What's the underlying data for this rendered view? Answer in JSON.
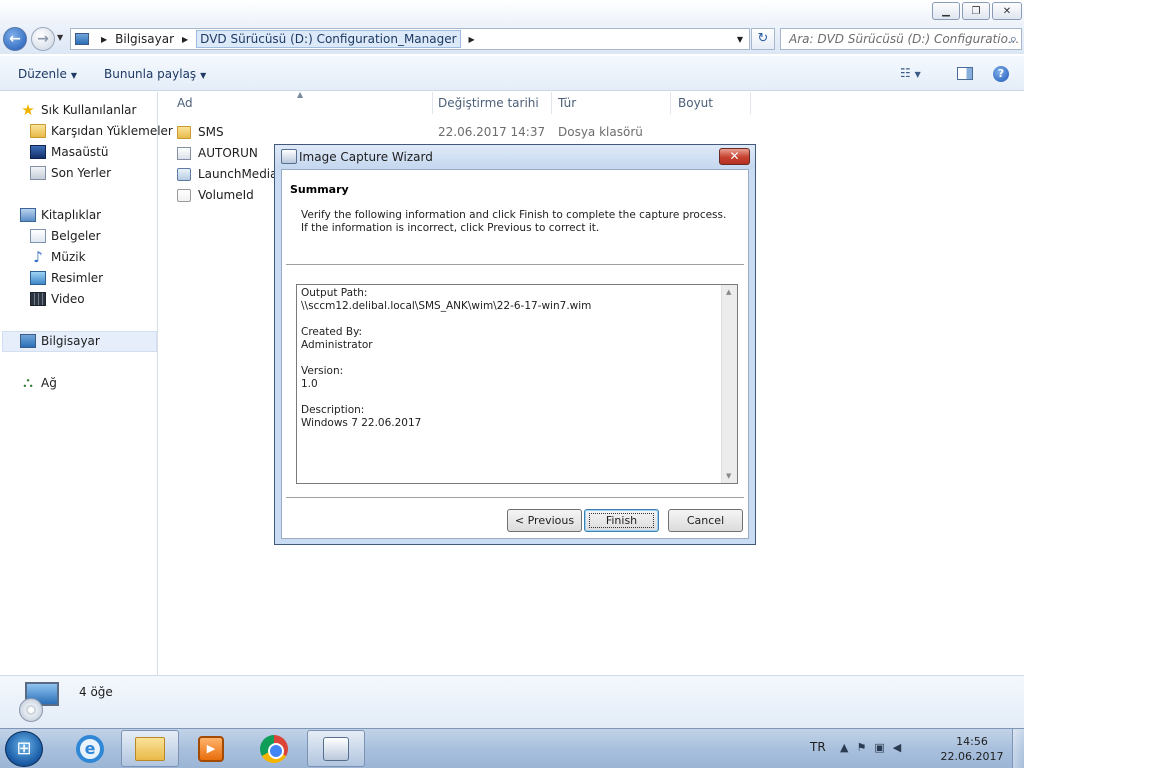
{
  "address": {
    "crumbs": [
      "Bilgisayar",
      "DVD Sürücüsü (D:) Configuration_Manager"
    ],
    "search_placeholder": "Ara: DVD Sürücüsü (D:) Configuratio..."
  },
  "toolbar": {
    "organize_label": "Düzenle",
    "share_label": "Bununla paylaş"
  },
  "nav": {
    "favorites": {
      "label": "Sık Kullanılanlar",
      "items": [
        "Karşıdan Yüklemeler",
        "Masaüstü",
        "Son Yerler"
      ]
    },
    "libraries": {
      "label": "Kitaplıklar",
      "items": [
        "Belgeler",
        "Müzik",
        "Resimler",
        "Video"
      ]
    },
    "computer_label": "Bilgisayar",
    "network_label": "Ağ"
  },
  "columns": [
    "Ad",
    "Değiştirme tarihi",
    "Tür",
    "Boyut"
  ],
  "files": [
    {
      "name": "SMS",
      "date": "22.06.2017 14:37",
      "type": "Dosya klasörü",
      "icon": "folder-icon"
    },
    {
      "name": "AUTORUN",
      "icon": "config-file-icon"
    },
    {
      "name": "LaunchMedia",
      "icon": "media-file-icon"
    },
    {
      "name": "VolumeId",
      "icon": "file-icon"
    }
  ],
  "details": {
    "count": "4 öğe"
  },
  "wizard": {
    "title": "Image Capture Wizard",
    "close_label": "✕",
    "header": "Summary",
    "description": "Verify the following information and click Finish to complete the capture process.  If the information is incorrect, click Previous to correct it.",
    "summary": {
      "output_path_label": "Output Path:",
      "output_path": "\\\\sccm12.delibal.local\\SMS_ANK\\wim\\22-6-17-win7.wim",
      "created_by_label": "Created By:",
      "created_by": "Administrator",
      "version_label": "Version:",
      "version": "1.0",
      "description_label": "Description:",
      "description": "Windows 7 22.06.2017"
    },
    "buttons": {
      "previous": "< Previous",
      "finish": "Finish",
      "cancel": "Cancel"
    }
  },
  "taskbar": {
    "language": "TR",
    "time": "14:56",
    "date": "22.06.2017"
  },
  "colors": {
    "accent": "#1e58b8",
    "selection": "#e5eefa",
    "close_red": "#c7402f"
  }
}
